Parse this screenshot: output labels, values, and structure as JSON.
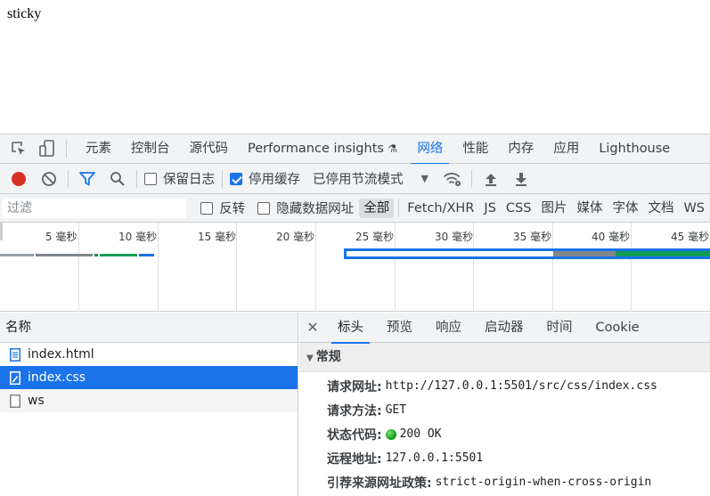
{
  "page": {
    "text": "sticky"
  },
  "main_tabs": [
    "元素",
    "控制台",
    "源代码",
    "Performance insights",
    "网络",
    "性能",
    "内存",
    "应用",
    "Lighthouse"
  ],
  "toolbar": {
    "preserve_log": "保留日志",
    "disable_cache": "停用缓存",
    "throttle": "已停用节流模式"
  },
  "filter": {
    "placeholder": "过滤",
    "invert": "反转",
    "hide_data_urls": "隐藏数据网址",
    "types": [
      "全部",
      "Fetch/XHR",
      "JS",
      "CSS",
      "图片",
      "媒体",
      "字体",
      "文档",
      "WS"
    ]
  },
  "timeline": {
    "ticks": [
      "5 毫秒",
      "10 毫秒",
      "15 毫秒",
      "20 毫秒",
      "25 毫秒",
      "30 毫秒",
      "35 毫秒",
      "40 毫秒",
      "45 毫秒"
    ]
  },
  "requests": {
    "header": "名称",
    "rows": [
      {
        "name": "index.html",
        "icon": "document-icon",
        "selected": false
      },
      {
        "name": "index.css",
        "icon": "stylesheet-icon",
        "selected": true
      },
      {
        "name": "ws",
        "icon": "blank-file-icon",
        "selected": false
      }
    ]
  },
  "details": {
    "tabs": [
      "标头",
      "预览",
      "响应",
      "启动器",
      "时间",
      "Cookie"
    ],
    "active_tab": "标头",
    "section": "常规",
    "general": {
      "url_label": "请求网址:",
      "url": "http://127.0.0.1:5501/src/css/index.css",
      "method_label": "请求方法:",
      "method": "GET",
      "status_label": "状态代码:",
      "status": "200 OK",
      "remote_label": "远程地址:",
      "remote": "127.0.0.1:5501",
      "referrer_label": "引荐来源网址政策:",
      "referrer": "strict-origin-when-cross-origin"
    }
  },
  "colors": {
    "accent": "#1a73e8",
    "record": "#d93025",
    "status_green": "#0a9b0a"
  }
}
